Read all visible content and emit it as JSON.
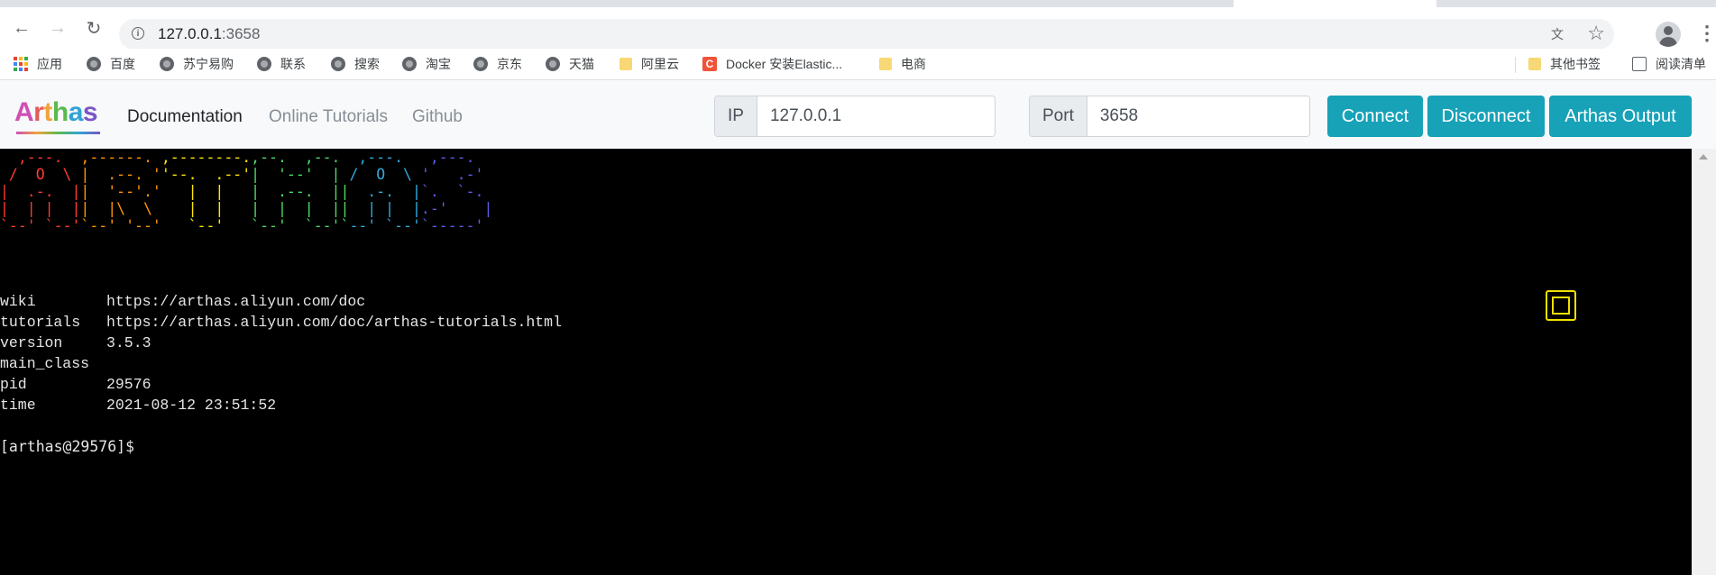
{
  "browser": {
    "url_host": "127.0.0.1",
    "url_port": ":3658",
    "bookmarks": [
      {
        "label": "应用",
        "icon": "apps-grid-icon"
      },
      {
        "label": "百度",
        "icon": "globe-icon"
      },
      {
        "label": "苏宁易购",
        "icon": "globe-icon"
      },
      {
        "label": "联系",
        "icon": "globe-icon"
      },
      {
        "label": "搜索",
        "icon": "globe-icon"
      },
      {
        "label": "淘宝",
        "icon": "globe-icon"
      },
      {
        "label": "京东",
        "icon": "globe-icon"
      },
      {
        "label": "天猫",
        "icon": "globe-icon"
      },
      {
        "label": "阿里云",
        "icon": "folder-icon"
      },
      {
        "label": "Docker 安装Elastic...",
        "icon": "c-icon"
      },
      {
        "label": "电商",
        "icon": "folder-icon"
      },
      {
        "label": "其他书签",
        "icon": "folder-icon"
      },
      {
        "label": "阅读清单",
        "icon": "reading-list-icon"
      }
    ]
  },
  "app": {
    "logo": [
      "A",
      "r",
      "t",
      "h",
      "a",
      "s"
    ],
    "nav": [
      "Documentation",
      "Online Tutorials",
      "Github"
    ],
    "ip_label": "IP",
    "ip_value": "127.0.0.1",
    "port_label": "Port",
    "port_value": "3658",
    "buttons": [
      "Connect",
      "Disconnect",
      "Arthas Output"
    ],
    "accent_color": "#17a2b8"
  },
  "terminal": {
    "info": [
      {
        "key": "wiki",
        "value": "https://arthas.aliyun.com/doc"
      },
      {
        "key": "tutorials",
        "value": "https://arthas.aliyun.com/doc/arthas-tutorials.html"
      },
      {
        "key": "version",
        "value": "3.5.3"
      },
      {
        "key": "main_class",
        "value": ""
      },
      {
        "key": "pid",
        "value": "29576"
      },
      {
        "key": "time",
        "value": "2021-08-12 23:51:52"
      }
    ],
    "prompt": "[arthas@29576]$"
  }
}
